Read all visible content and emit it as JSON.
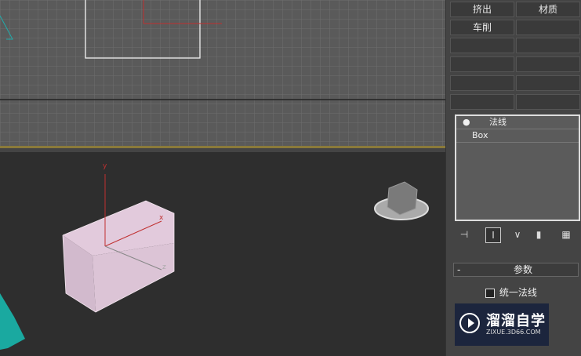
{
  "modifiers": {
    "extrude": "挤出",
    "material": "材质",
    "lathe": "车削"
  },
  "stack": {
    "items": [
      "法线",
      "Box"
    ]
  },
  "rollout": {
    "title": "参数",
    "collapse": "-",
    "unify_normals": "统一法线"
  },
  "viewport": {
    "axis_y": "y",
    "axis_z": "z",
    "axis_x": "x"
  },
  "watermark": {
    "brand": "溜溜自学",
    "url": "ZIXUE.3D66.COM"
  },
  "colors": {
    "grid_bg": "#5a5a5a",
    "active_border": "#8a7a3a",
    "box_fill": "#e2c8dc"
  }
}
